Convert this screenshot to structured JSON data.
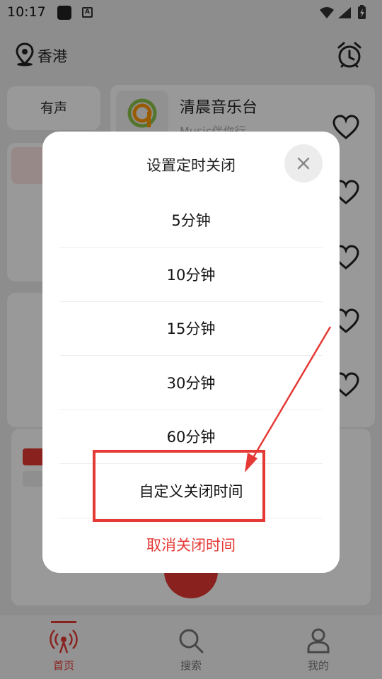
{
  "status_bar": {
    "time": "10:17"
  },
  "header": {
    "location": "香港"
  },
  "background": {
    "tag_label": "有声",
    "station": {
      "title": "清晨音乐台",
      "subtitle": "Music伴你行"
    }
  },
  "dialog": {
    "title": "设置定时关闭",
    "options": [
      {
        "label": "5分钟"
      },
      {
        "label": "10分钟"
      },
      {
        "label": "15分钟"
      },
      {
        "label": "30分钟"
      },
      {
        "label": "60分钟"
      },
      {
        "label": "自定义关闭时间"
      }
    ],
    "cancel_label": "取消关闭时间"
  },
  "bottom_nav": {
    "items": [
      {
        "label": "首页",
        "icon": "radio-icon",
        "active": true
      },
      {
        "label": "搜索",
        "icon": "search-icon",
        "active": false
      },
      {
        "label": "我的",
        "icon": "user-icon",
        "active": false
      }
    ]
  },
  "colors": {
    "accent": "#e53935",
    "overlay": "rgba(0,0,0,0.40)",
    "dialog_bg": "#ffffff"
  }
}
